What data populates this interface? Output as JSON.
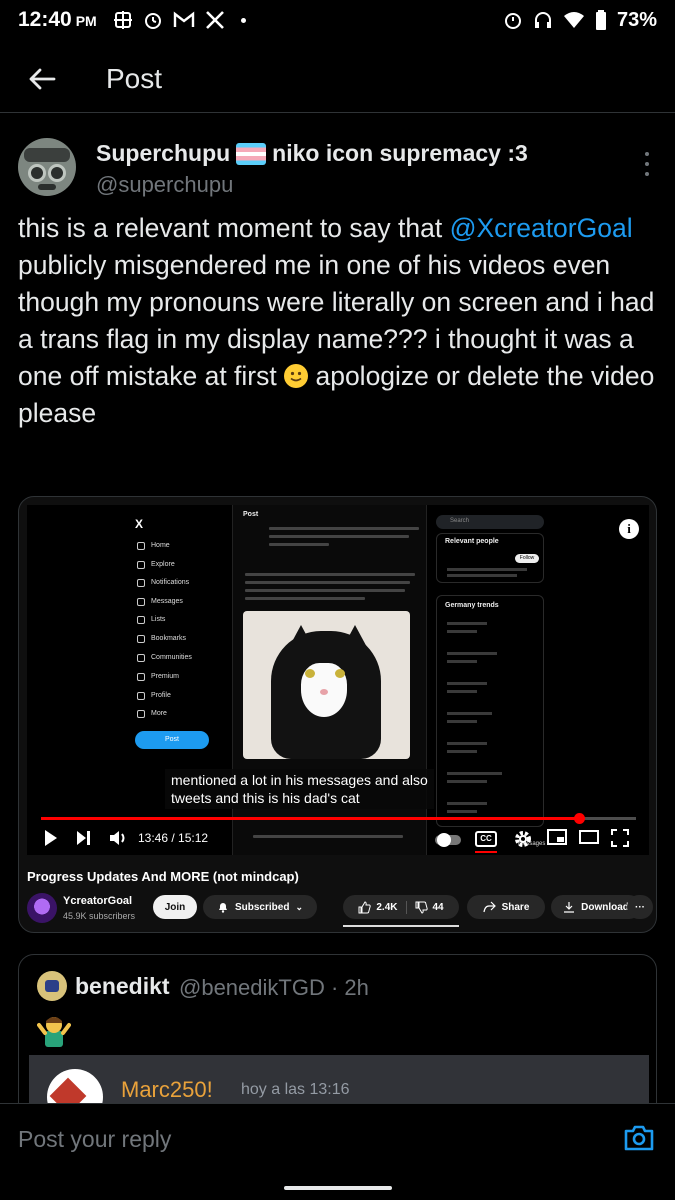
{
  "status_bar": {
    "time": "12:40",
    "ampm": "PM",
    "battery": "73%",
    "left_icons": [
      "grid-icon",
      "alarm-icon",
      "gmail-icon",
      "x-icon",
      "dot-icon"
    ],
    "right_icons": [
      "alarm-icon",
      "headset-icon",
      "wifi-icon",
      "battery-icon"
    ]
  },
  "header": {
    "title": "Post"
  },
  "post": {
    "display_name": "Superchupu",
    "display_name_suffix": "niko icon supremacy :3",
    "handle": "@superchupu",
    "text_part1": "this is a relevant moment to say that ",
    "mention": "@XcreatorGoal",
    "text_part2": " publicly misgendered me in one of his videos even though my pronouns were literally on screen and i had a trans flag in my display name??? i thought it was a one off mistake at first ",
    "text_part3": " apologize or delete the video please"
  },
  "media": {
    "subtitle_line1": "mentioned a lot in his messages and also",
    "subtitle_line2": "tweets and this is his dad's cat",
    "time": "13:46 / 15:12",
    "progress": 0.905,
    "video_title": "Progress Updates And MORE (not mindcap)",
    "channel": "YcreatorGoal",
    "subscribers": "45.9K subscribers",
    "join_label": "Join",
    "subscribed_label": "Subscribed",
    "likes": "2.4K",
    "dislikes": "44",
    "share_label": "Share",
    "download_label": "Download",
    "info_icon": "i",
    "cc_label": "CC",
    "embedded_screen": {
      "sidebar_items": [
        "Home",
        "Explore",
        "Notifications",
        "Messages",
        "Lists",
        "Bookmarks",
        "Communities",
        "Premium",
        "Profile",
        "More"
      ],
      "post_button": "Post",
      "center_title": "Post",
      "right_search": "Search",
      "relevant_people": "Relevant people",
      "follow": "Follow",
      "trends_title": "Germany trends",
      "messages_label": "Messages"
    }
  },
  "quoted_post": {
    "name": "benedikt",
    "handle": "@benedikTGD",
    "time": "· 2h",
    "inner_name": "Marc250!",
    "inner_time": "hoy a las 13:16"
  },
  "reply": {
    "placeholder": "Post your reply"
  },
  "colors": {
    "accent": "#1d9bf0",
    "background": "#000000",
    "muted": "#71767b",
    "youtube_red": "#ff0000"
  }
}
